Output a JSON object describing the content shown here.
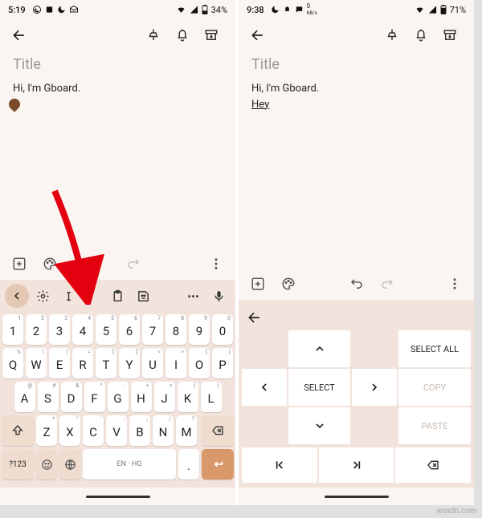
{
  "left": {
    "status": {
      "time": "5:19",
      "battery": "34%"
    },
    "note": {
      "title_placeholder": "Title",
      "line1": "Hi, I'm Gboard."
    },
    "keyboard": {
      "row_num": [
        [
          "1",
          "1"
        ],
        [
          "2",
          "2"
        ],
        [
          "3",
          "3"
        ],
        [
          "4",
          "4"
        ],
        [
          "5",
          "5"
        ],
        [
          "6",
          "6"
        ],
        [
          "7",
          "7"
        ],
        [
          "8",
          "8"
        ],
        [
          "9",
          "9"
        ],
        [
          "0",
          "0"
        ]
      ],
      "row_q": [
        [
          "Q",
          "%"
        ],
        [
          "W",
          "\\"
        ],
        [
          "E",
          "|"
        ],
        [
          "R",
          "="
        ],
        [
          "T",
          "["
        ],
        [
          "Y",
          "]"
        ],
        [
          "U",
          "<"
        ],
        [
          "I",
          ">"
        ],
        [
          "O",
          "{"
        ],
        [
          "P",
          "}"
        ]
      ],
      "row_a": [
        [
          "A",
          "@"
        ],
        [
          "S",
          "#"
        ],
        [
          "D",
          "&"
        ],
        [
          "F",
          "*"
        ],
        [
          "G",
          "-"
        ],
        [
          "H",
          "+"
        ],
        [
          "J",
          "="
        ],
        [
          "K",
          "("
        ],
        [
          "L",
          ")"
        ]
      ],
      "row_z": [
        [
          "Z",
          "*"
        ],
        [
          "X",
          "\""
        ],
        [
          "C",
          "'"
        ],
        [
          "V",
          ":"
        ],
        [
          "B",
          ";"
        ],
        [
          "N",
          "/"
        ],
        [
          "M",
          "?"
        ]
      ],
      "sym_key": "?123",
      "space_label": "EN · HG"
    }
  },
  "right": {
    "status": {
      "time": "9:38",
      "kbps": "0",
      "kbps_unit": "KB/s",
      "battery": "71%"
    },
    "note": {
      "title_placeholder": "Title",
      "line1": "Hi, I'm Gboard.",
      "line2": "Hey"
    },
    "cursor_panel": {
      "select_all": "SELECT ALL",
      "select": "SELECT",
      "copy": "COPY",
      "paste": "PASTE"
    }
  },
  "watermark": "wsxdn.com"
}
